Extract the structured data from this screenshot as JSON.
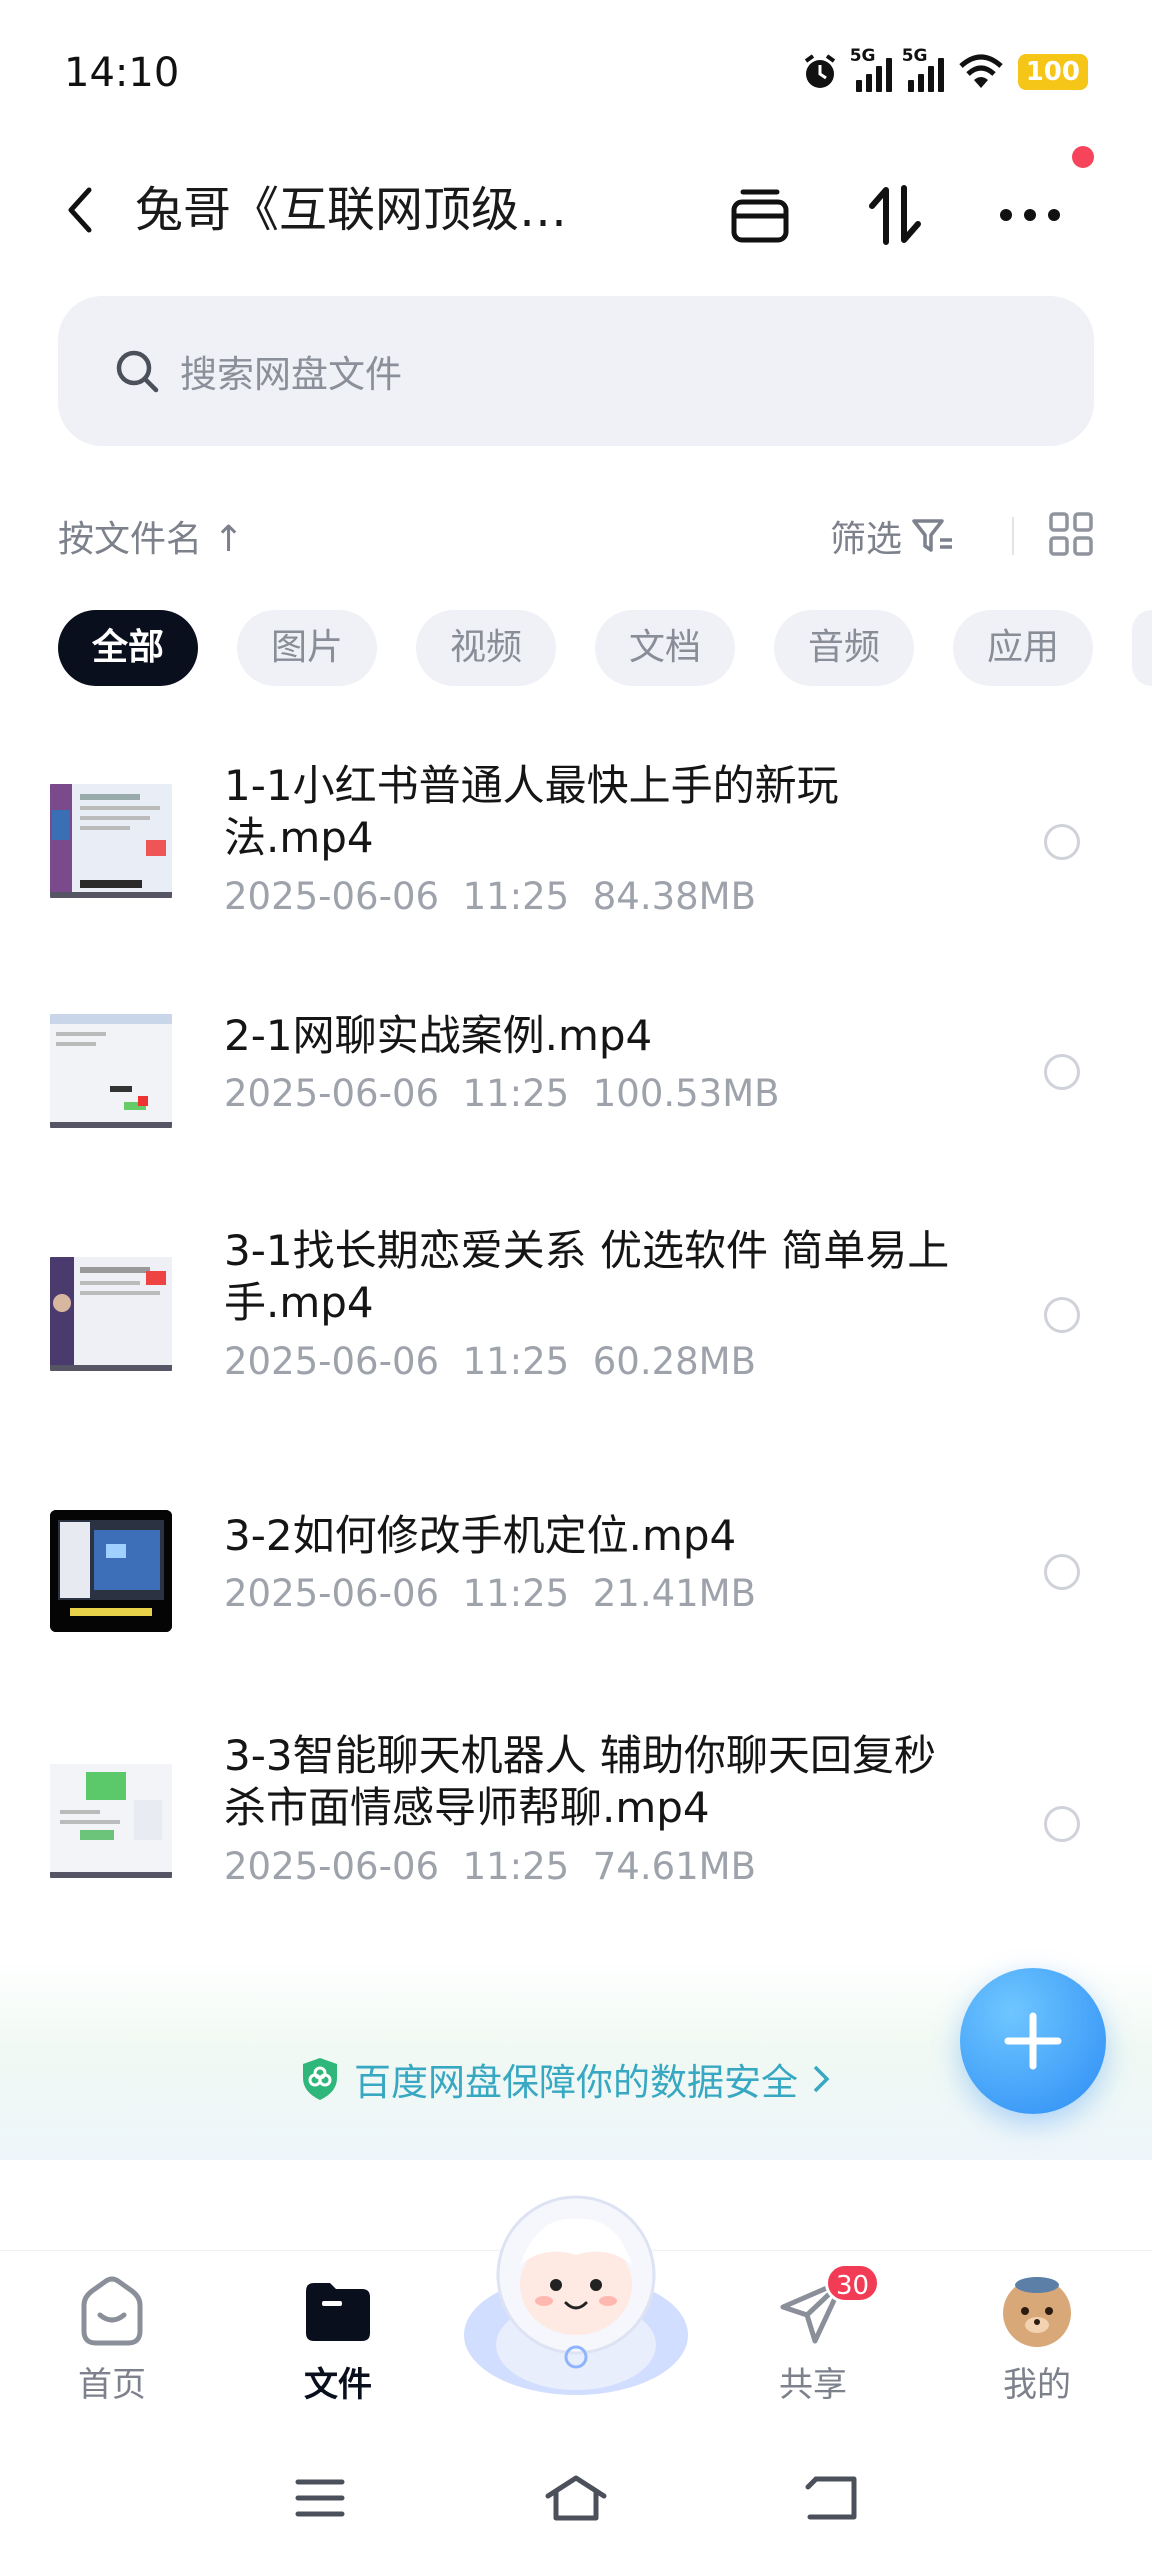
{
  "status_bar": {
    "time": "14:10",
    "signal1_label": "5G",
    "signal2_label": "5G",
    "battery": "100"
  },
  "header": {
    "title": "兔哥《互联网顶级…",
    "notification_dot_color": "#f6455a"
  },
  "search": {
    "placeholder": "搜索网盘文件"
  },
  "sort": {
    "label": "按文件名 ↑",
    "filter_label": "筛选"
  },
  "chips": [
    "全部",
    "图片",
    "视频",
    "文档",
    "音频",
    "应用"
  ],
  "files": [
    {
      "name": "1-1小红书普通人最快上手的新玩法.mp4",
      "date": "2025-06-06",
      "time": "11:25",
      "size": "84.38MB"
    },
    {
      "name": "2-1网聊实战案例.mp4",
      "date": "2025-06-06",
      "time": "11:25",
      "size": "100.53MB"
    },
    {
      "name": "3-1找长期恋爱关系 优选软件 简单易上手.mp4",
      "date": "2025-06-06",
      "time": "11:25",
      "size": "60.28MB"
    },
    {
      "name": "3-2如何修改手机定位.mp4",
      "date": "2025-06-06",
      "time": "11:25",
      "size": "21.41MB"
    },
    {
      "name": "3-3智能聊天机器人 辅助你聊天回复秒杀市面情感导师帮聊.mp4",
      "date": "2025-06-06",
      "time": "11:25",
      "size": "74.61MB"
    }
  ],
  "banner": {
    "text": "百度网盘保障你的数据安全"
  },
  "bottom_nav": {
    "home": "首页",
    "files": "文件",
    "share": "共享",
    "share_badge": "30",
    "me": "我的"
  },
  "colors": {
    "accent": "#2c8df5",
    "active_chip": "#0a0f1e",
    "banner_text": "#38a8c2"
  }
}
